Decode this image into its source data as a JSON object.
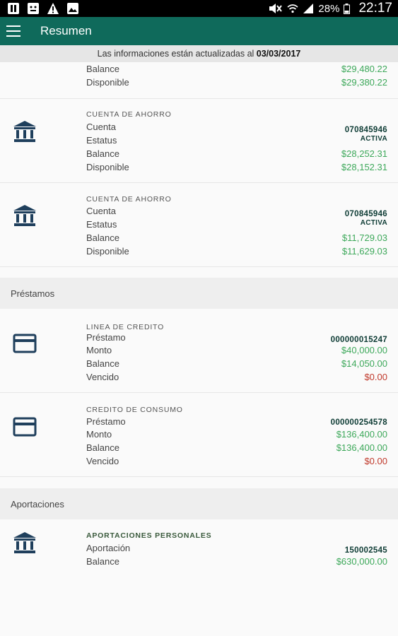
{
  "status_bar": {
    "battery": "28%",
    "time": "22:17"
  },
  "app_bar": {
    "title": "Resumen"
  },
  "info": {
    "prefix": "Las informaciones están actualizadas al ",
    "date": "03/03/2017"
  },
  "accounts": {
    "partial": {
      "rows": [
        {
          "label": "Balance",
          "value": "$29,480.22"
        },
        {
          "label": "Disponible",
          "value": "$29,380.22"
        }
      ]
    },
    "items": [
      {
        "type": "CUENTA DE AHORRO",
        "rows": [
          {
            "label": "Cuenta",
            "value": "070845946"
          },
          {
            "label": "Estatus",
            "value": "ACTIVA"
          },
          {
            "label": "Balance",
            "value": "$28,252.31"
          },
          {
            "label": "Disponible",
            "value": "$28,152.31"
          }
        ]
      },
      {
        "type": "CUENTA DE AHORRO",
        "rows": [
          {
            "label": "Cuenta",
            "value": "070845946"
          },
          {
            "label": "Estatus",
            "value": "ACTIVA"
          },
          {
            "label": "Balance",
            "value": "$11,729.03"
          },
          {
            "label": "Disponible",
            "value": "$11,629.03"
          }
        ]
      }
    ]
  },
  "loans": {
    "section_title": "Préstamos",
    "items": [
      {
        "type": "LINEA DE CREDITO",
        "rows": [
          {
            "label": "Préstamo",
            "value": "000000015247"
          },
          {
            "label": "Monto",
            "value": "$40,000.00"
          },
          {
            "label": "Balance",
            "value": "$14,050.00"
          },
          {
            "label": "Vencido",
            "value": "$0.00"
          }
        ]
      },
      {
        "type": "CREDITO DE CONSUMO",
        "rows": [
          {
            "label": "Préstamo",
            "value": "000000254578"
          },
          {
            "label": "Monto",
            "value": "$136,400.00"
          },
          {
            "label": "Balance",
            "value": "$136,400.00"
          },
          {
            "label": "Vencido",
            "value": "$0.00"
          }
        ]
      }
    ]
  },
  "contributions": {
    "section_title": "Aportaciones",
    "items": [
      {
        "type": "APORTACIONES PERSONALES",
        "rows": [
          {
            "label": "Aportación",
            "value": "150002545"
          },
          {
            "label": "Balance",
            "value": "$630,000.00"
          }
        ]
      }
    ]
  },
  "icons": {
    "bank": "bank-icon",
    "card": "credit-card-icon",
    "menu": "menu-icon"
  },
  "colors": {
    "app_bar": "#0f6a5b",
    "positive": "#3da85a",
    "negative": "#c0392b",
    "icon": "#1f3f5c"
  }
}
